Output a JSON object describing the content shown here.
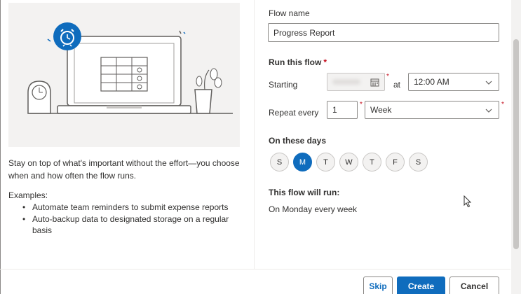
{
  "left": {
    "description": "Stay on top of what's important without the effort—you choose when and how often the flow runs.",
    "examples_title": "Examples:",
    "examples": [
      "Automate team reminders to submit expense reports",
      "Auto-backup data to designated storage on a regular basis"
    ]
  },
  "form": {
    "flow_name_label": "Flow name",
    "flow_name_value": "Progress Report",
    "run_label": "Run this flow",
    "required_mark": "*",
    "starting_label": "Starting",
    "at_label": "at",
    "time_value": "12:00 AM",
    "repeat_label": "Repeat every",
    "repeat_count": "1",
    "repeat_unit": "Week",
    "days_label": "On these days",
    "days": [
      {
        "letter": "S",
        "active": false
      },
      {
        "letter": "M",
        "active": true
      },
      {
        "letter": "T",
        "active": false
      },
      {
        "letter": "W",
        "active": false
      },
      {
        "letter": "T",
        "active": false
      },
      {
        "letter": "F",
        "active": false
      },
      {
        "letter": "S",
        "active": false
      }
    ],
    "will_run_label": "This flow will run:",
    "will_run_value": "On Monday every week"
  },
  "footer": {
    "skip_label": "Skip",
    "create_label": "Create",
    "cancel_label": "Cancel"
  },
  "colors": {
    "accent": "#0f6cbd",
    "required": "#c50f1f",
    "illustration_bg": "#f3f2f1"
  },
  "icons": {
    "alarm": "alarm-clock-icon",
    "calendar": "calendar-icon",
    "chevron": "chevron-down-icon"
  }
}
